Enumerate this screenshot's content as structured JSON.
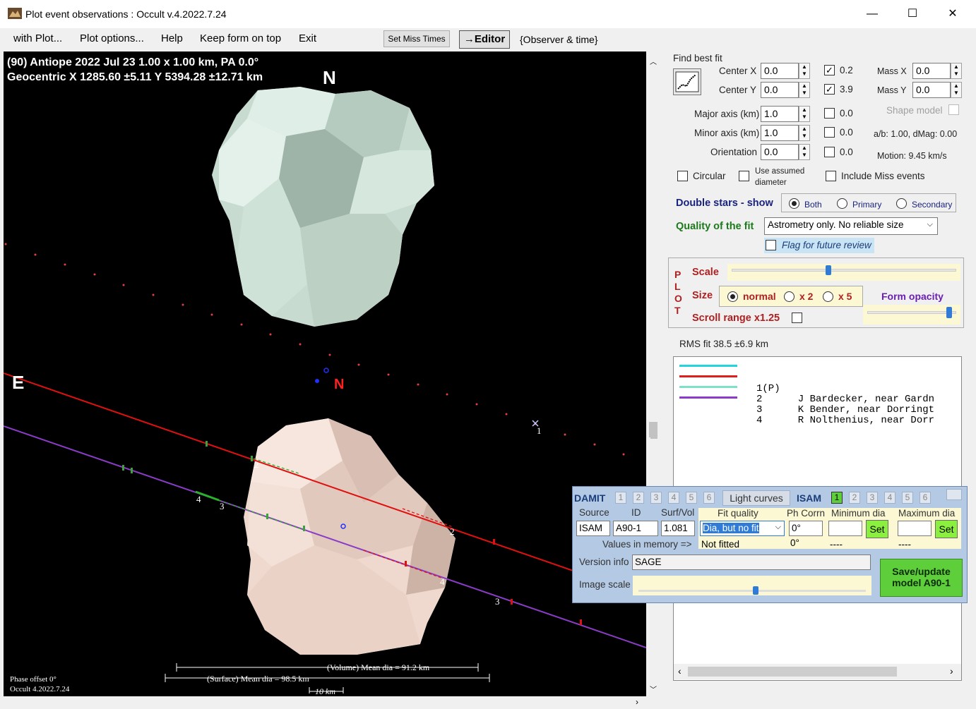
{
  "window": {
    "title": "Plot event observations : Occult v.4.2022.7.24",
    "minimize": "—",
    "maximize": "☐",
    "close": "✕"
  },
  "menu": {
    "with_plot": "with Plot...",
    "plot_options": "Plot options...",
    "help": "Help",
    "keep_on_top": "Keep form on top",
    "exit": "Exit",
    "set_miss_times": "Set Miss Times",
    "editor": "→Editor",
    "observer_time": "{Observer & time}"
  },
  "plot": {
    "header_line1": "(90) Antiope  2022 Jul 23  1.00 x 1.00 km, PA 0.0°",
    "header_line2": "Geocentric  X  1285.60 ±5.11  Y 5394.28 ±12.71 km",
    "north_label": "N",
    "east_label": "E",
    "north_small": "N",
    "chord_labels": [
      "1",
      "2",
      "2",
      "3",
      "3",
      "4",
      "4"
    ],
    "volume_dia": "(Volume) Mean dia = 91.2 km",
    "surface_dia": "(Surface) Mean dia = 98.5 km",
    "scale_10km": "10 km",
    "phase_offset": "Phase offset 0°",
    "occult_version": "Occult 4.2022.7.24"
  },
  "fit": {
    "heading": "Find best fit",
    "center_x_label": "Center X",
    "center_x": "0.0",
    "center_y_label": "Center Y",
    "center_y": "0.0",
    "major_label": "Major axis (km)",
    "major": "1.0",
    "minor_label": "Minor axis (km)",
    "minor": "1.0",
    "orient_label": "Orientation",
    "orient": "0.0",
    "cx_step": "0.2",
    "cy_step": "3.9",
    "major_step": "0.0",
    "minor_step": "0.0",
    "orient_step": "0.0",
    "mass_x_label": "Mass X",
    "mass_x": "0.0",
    "mass_y_label": "Mass Y",
    "mass_y": "0.0",
    "shape_model": "Shape model",
    "ab_dmag": "a/b: 1.00, dMag: 0.00",
    "motion": "Motion: 9.45 km/s",
    "circular": "Circular",
    "use_assumed": "Use assumed diameter",
    "include_miss": "Include Miss events"
  },
  "double_stars": {
    "label": "Double stars - show",
    "both": "Both",
    "primary": "Primary",
    "secondary": "Secondary"
  },
  "quality": {
    "label": "Quality of the fit",
    "value": "Astrometry only. No reliable size",
    "flag": "Flag for future review"
  },
  "plot_box": {
    "side": "P L O T",
    "scale": "Scale",
    "size": "Size",
    "normal": "normal",
    "x2": "x 2",
    "x5": "x 5",
    "form_opacity": "Form opacity",
    "scroll_range": "Scroll range x1.25",
    "scale_level": 0.43,
    "opacity_level": 0.95
  },
  "rms": "RMS fit 38.5 ±6.9 km",
  "legend": [
    {
      "num": "1",
      "text": "1(P)",
      "color": "#22d3e0"
    },
    {
      "num": "2",
      "text": "2      J Bardecker, near Gardn",
      "color": "#e01e1e"
    },
    {
      "num": "3",
      "text": "3      K Bender, near Dorringt",
      "color": "#7ee0c8"
    },
    {
      "num": "4",
      "text": "4      R Nolthenius, near Dorr",
      "color": "#8a3cc8"
    }
  ],
  "damit": {
    "damit_label": "DAMIT",
    "damit_nums": [
      "1",
      "2",
      "3",
      "4",
      "5",
      "6"
    ],
    "light_curves": "Light curves",
    "isam_label": "ISAM",
    "isam_nums": [
      "1",
      "2",
      "3",
      "4",
      "5",
      "6"
    ],
    "source_label": "Source",
    "id_label": "ID",
    "surfvol_label": "Surf/Vol",
    "source": "ISAM",
    "id": "A90-1",
    "surfvol": "1.081",
    "fit_quality_label": "Fit quality",
    "fit_quality": "Dia, but no fit",
    "phcorr_label": "Ph Corrn",
    "phcorr": "0°",
    "min_dia_label": "Minimum dia",
    "max_dia_label": "Maximum dia",
    "set": "Set",
    "values_mem": "Values in memory =>",
    "mem_fit": "Not fitted",
    "mem_ph": "0°",
    "mem_min": "----",
    "mem_max": "----",
    "version_label": "Version info",
    "version": "SAGE",
    "image_scale": "Image scale",
    "save_btn": "Save/update model A90-1"
  }
}
